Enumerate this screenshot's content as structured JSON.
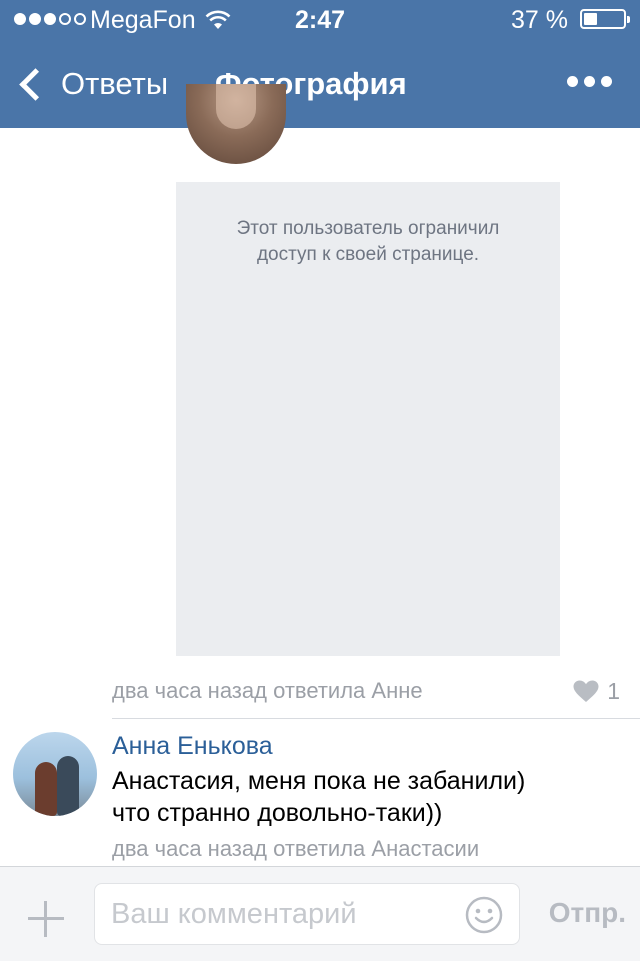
{
  "status_bar": {
    "carrier": "MegaFon",
    "time": "2:47",
    "battery_percent": "37 %",
    "signal_bars_filled": 3,
    "signal_bars_total": 5,
    "battery_level": 0.37
  },
  "nav": {
    "back_label": "Ответы",
    "title": "Фотография"
  },
  "photo": {
    "restricted_text": "Этот пользователь ограничил\nдоступ к своей странице."
  },
  "post_meta": {
    "time_text": "два часа назад ответила Анне",
    "likes": "1"
  },
  "comment": {
    "author": "Анна Енькова",
    "text": "Анастасия, меня пока не забанили)\nчто странно довольно-таки))",
    "meta": "два часа назад ответила Анастасии"
  },
  "composer": {
    "placeholder": "Ваш комментарий",
    "value": "",
    "send_label": "Отпр."
  },
  "colors": {
    "header_bg": "#4a75a8",
    "link": "#2b5f98",
    "meta_gray": "#9b9fa6"
  },
  "icons": [
    "chevron-left-icon",
    "more-dots-icon",
    "wifi-icon",
    "battery-icon",
    "heart-icon",
    "plus-icon",
    "smiley-icon"
  ]
}
